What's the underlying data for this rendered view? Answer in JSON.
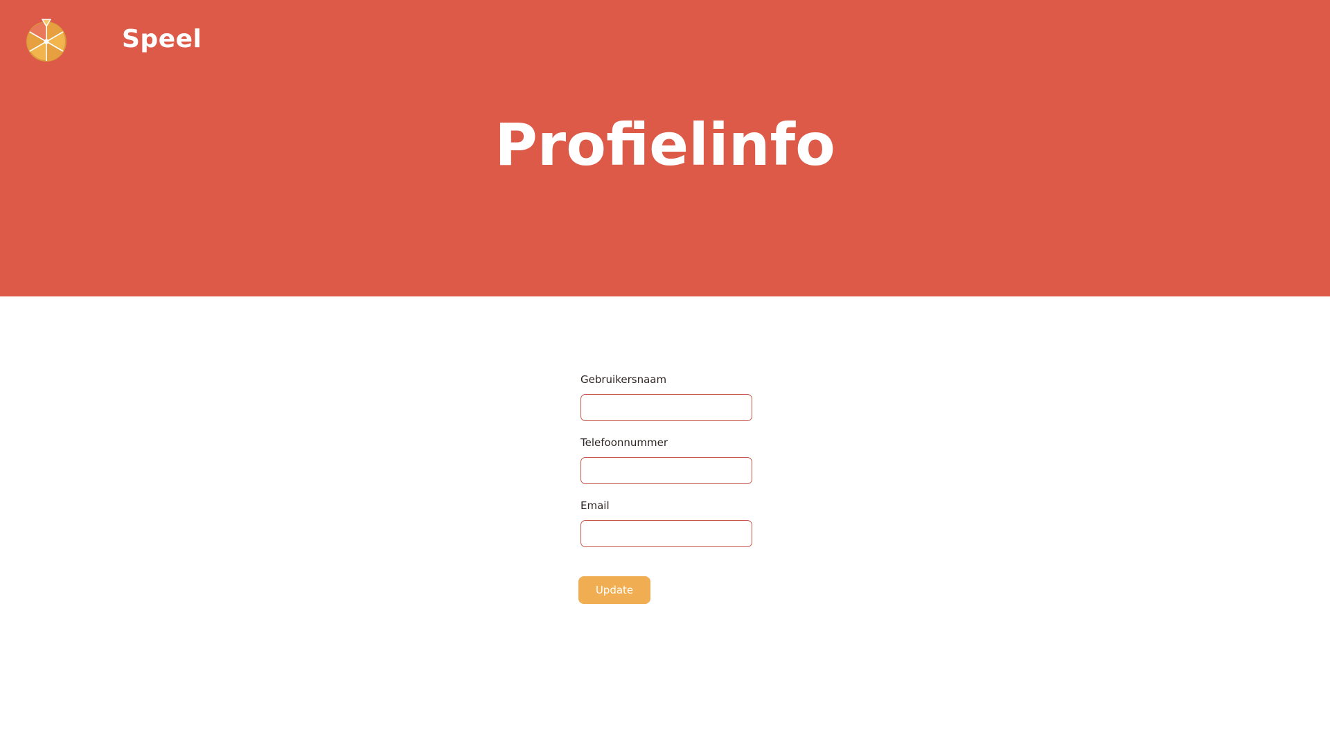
{
  "header": {
    "brand": "Speel",
    "logo_icon": "prize-wheel-icon"
  },
  "page": {
    "title": "Profielinfo"
  },
  "form": {
    "fields": [
      {
        "label": "Gebruikersnaam",
        "value": "",
        "placeholder": ""
      },
      {
        "label": "Telefoonnummer",
        "value": "",
        "placeholder": ""
      },
      {
        "label": "Email",
        "value": "",
        "placeholder": ""
      }
    ],
    "submit_label": "Update"
  },
  "colors": {
    "hero_background": "#dd5948",
    "input_border": "#c6574a",
    "button_background": "#f0ad52",
    "text_light": "#ffffff",
    "text_dark": "#2e2624"
  }
}
